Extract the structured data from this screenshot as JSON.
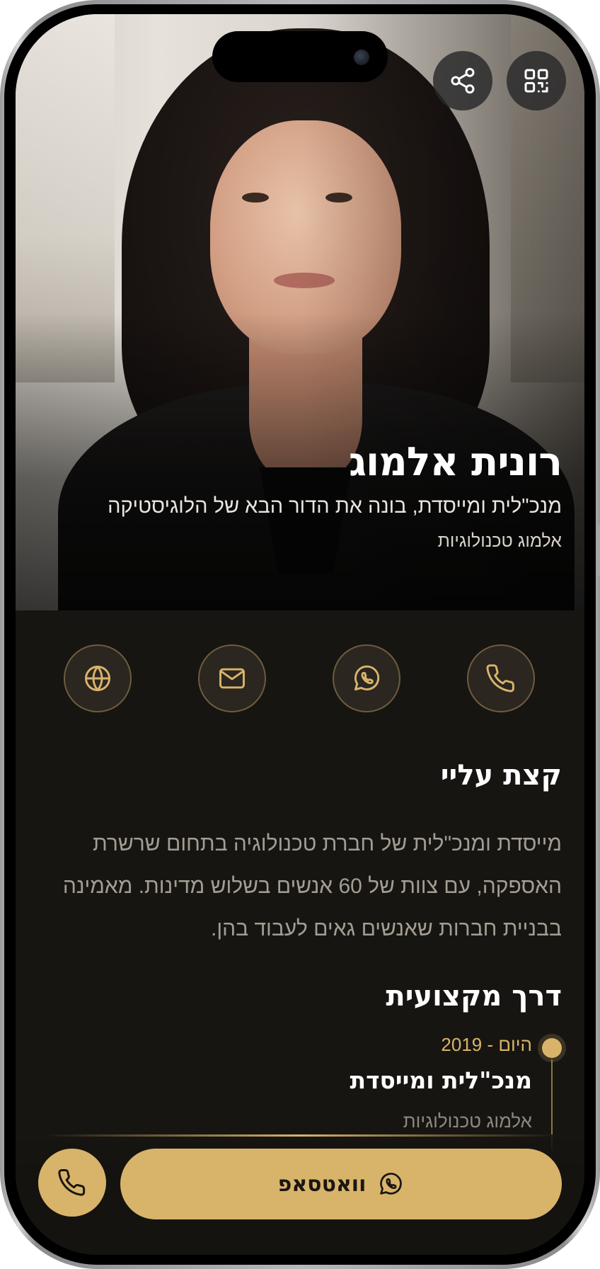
{
  "profile": {
    "name": "רונית אלמוג",
    "title": "מנכ\"לית ומייסדת, בונה את הדור הבא של הלוגיסטיקה",
    "company": "אלמוג טכנולוגיות"
  },
  "header": {
    "share_icon": "share-icon",
    "qr_icon": "qr-code-icon"
  },
  "contacts": [
    {
      "icon": "phone-icon"
    },
    {
      "icon": "whatsapp-icon"
    },
    {
      "icon": "mail-icon"
    },
    {
      "icon": "globe-icon"
    }
  ],
  "about": {
    "heading": "קצת עליי",
    "lines": [
      "מייסדת ומנכ\"לית של חברת טכנולוגיה בתחום שרשרת",
      "האספקה, עם צוות של 60 אנשים בשלוש מדינות. מאמינה",
      "בבניית חברות שאנשים גאים לעבוד בהן."
    ]
  },
  "career": {
    "heading": "דרך מקצועית",
    "items": [
      {
        "date": "2019 - היום",
        "role": "מנכ\"לית ומייסדת",
        "company": "אלמוג טכנולוגיות"
      }
    ]
  },
  "cta": {
    "whatsapp_label": "וואטסאפ"
  },
  "colors": {
    "accent": "#d8b46a",
    "background": "#171511",
    "text_primary": "#ffffff",
    "text_muted": "#a39d94"
  }
}
